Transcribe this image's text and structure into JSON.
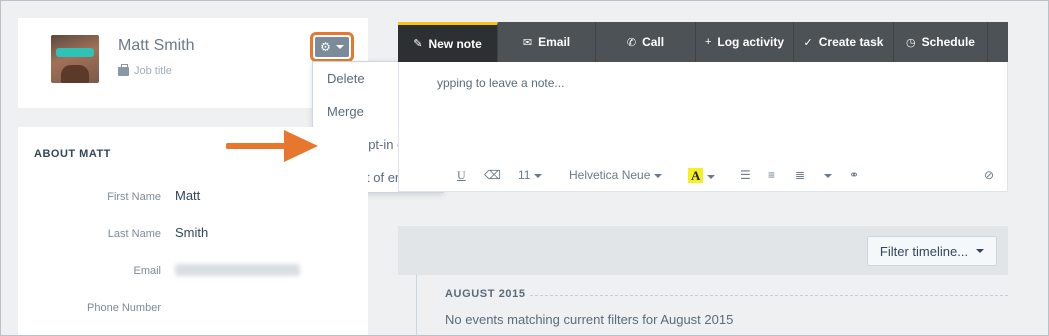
{
  "contact": {
    "name": "Matt Smith",
    "job_title_placeholder": "Job title"
  },
  "actions_menu": {
    "items": [
      "Delete",
      "Merge",
      "Send opt-in email",
      "Opt out of email"
    ]
  },
  "about": {
    "title": "ABOUT MATT",
    "fields": [
      {
        "label": "First Name",
        "value": "Matt"
      },
      {
        "label": "Last Name",
        "value": "Smith"
      },
      {
        "label": "Email",
        "value": ""
      },
      {
        "label": "Phone Number",
        "value": ""
      }
    ]
  },
  "tabs": [
    {
      "label": "New note",
      "icon": "pencil-icon"
    },
    {
      "label": "Email",
      "icon": "envelope-icon"
    },
    {
      "label": "Call",
      "icon": "phone-icon"
    },
    {
      "label": "Log activity",
      "icon": "plus-icon"
    },
    {
      "label": "Create task",
      "icon": "check-circle-icon"
    },
    {
      "label": "Schedule",
      "icon": "clock-icon"
    }
  ],
  "editor": {
    "placeholder": "ypping to leave a note...",
    "font_size": "11",
    "font_family": "Helvetica Neue",
    "highlight_letter": "A",
    "underline": "U"
  },
  "timeline": {
    "filter_label": "Filter timeline...",
    "month": "AUGUST 2015",
    "empty_message": "No events matching current filters for August 2015"
  },
  "colors": {
    "highlight_outline": "#e8772e",
    "active_tab_accent": "#f5c518",
    "tab_bar": "#4d5256"
  }
}
